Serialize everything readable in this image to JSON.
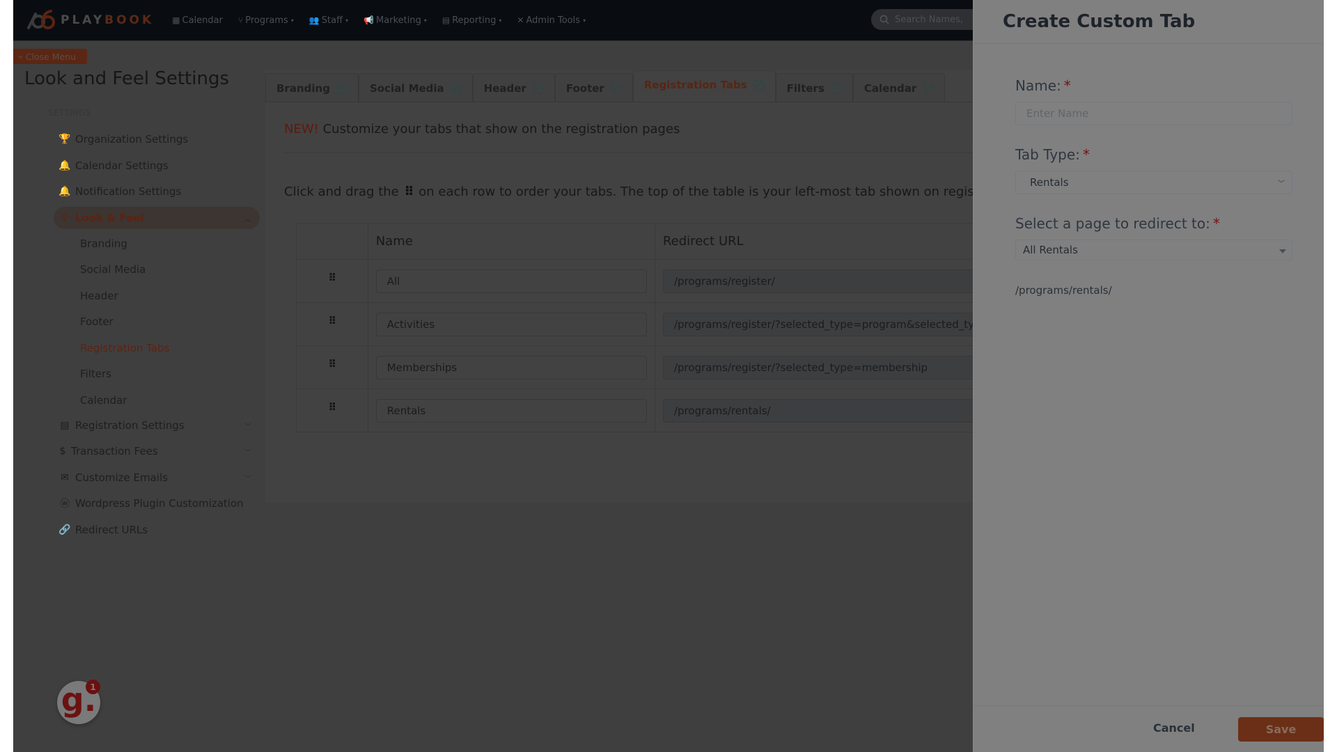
{
  "topnav": {
    "logo": {
      "part1": "PLAY",
      "part2": "BOOK"
    },
    "items": [
      {
        "label": "Calendar",
        "icon": "calendar-icon",
        "has_caret": false
      },
      {
        "label": "Programs",
        "icon": "branch-icon",
        "has_caret": true
      },
      {
        "label": "Staff",
        "icon": "users-icon",
        "has_caret": true
      },
      {
        "label": "Marketing",
        "icon": "megaphone-icon",
        "has_caret": true
      },
      {
        "label": "Reporting",
        "icon": "file-icon",
        "has_caret": true
      },
      {
        "label": "Admin Tools",
        "icon": "tools-icon",
        "has_caret": true
      }
    ],
    "search_placeholder": "Search Names,"
  },
  "close_menu_label": "Close Menu",
  "page_title": "Look and Feel Settings",
  "sidebar": {
    "header": "SETTINGS",
    "items": [
      {
        "label": "Organization Settings",
        "icon": "trophy-icon"
      },
      {
        "label": "Calendar Settings",
        "icon": "bell-icon"
      },
      {
        "label": "Notification Settings",
        "icon": "bell-icon"
      },
      {
        "label": "Look & Feel",
        "icon": "balloon-icon",
        "active": true,
        "expanded": true
      },
      {
        "label": "Registration Settings",
        "icon": "form-icon",
        "collapsible": true
      },
      {
        "label": "Transaction Fees",
        "icon": "dollar-icon",
        "collapsible": true
      },
      {
        "label": "Customize Emails",
        "icon": "envelope-icon",
        "collapsible": true
      },
      {
        "label": "Wordpress Plugin Customization",
        "icon": "wordpress-icon"
      },
      {
        "label": "Redirect URLs",
        "icon": "link-icon"
      }
    ],
    "look_feel_subitems": [
      {
        "label": "Branding"
      },
      {
        "label": "Social Media"
      },
      {
        "label": "Header"
      },
      {
        "label": "Footer"
      },
      {
        "label": "Registration Tabs",
        "current": true
      },
      {
        "label": "Filters"
      },
      {
        "label": "Calendar"
      }
    ]
  },
  "tabs": [
    {
      "label": "Branding",
      "complete": true
    },
    {
      "label": "Social Media",
      "complete": true
    },
    {
      "label": "Header",
      "complete": true
    },
    {
      "label": "Footer",
      "complete": true
    },
    {
      "label": "Registration Tabs",
      "complete": true,
      "active": true
    },
    {
      "label": "Filters",
      "complete": true
    },
    {
      "label": "Calendar",
      "complete": true
    }
  ],
  "content": {
    "notice_new": "NEW!",
    "notice_text": "Customize your tabs that show on the registration pages",
    "instructions_before": "Click and drag the",
    "instructions_after": "on each row to order your tabs. The top of the table is your left-most tab shown on registration pa",
    "table": {
      "columns": [
        "",
        "Name",
        "Redirect URL"
      ],
      "rows": [
        {
          "name": "All",
          "url": "/programs/register/"
        },
        {
          "name": "Activities",
          "url": "/programs/register/?selected_type=program&selected_ty"
        },
        {
          "name": "Memberships",
          "url": "/programs/register/?selected_type=membership"
        },
        {
          "name": "Rentals",
          "url": "/programs/rentals/"
        }
      ]
    }
  },
  "widget": {
    "letter": "g.",
    "badge_count": "1"
  },
  "drawer": {
    "title": "Create Custom Tab",
    "name_label": "Name:",
    "name_placeholder": "Enter Name",
    "name_value": "",
    "tab_type_label": "Tab Type:",
    "tab_type_value": "Rentals",
    "redirect_label": "Select a page to redirect to:",
    "redirect_value": "All Rentals",
    "redirect_preview": "/programs/rentals/",
    "required_marker": "*",
    "cancel_label": "Cancel",
    "save_label": "Save"
  },
  "colors": {
    "brand": "#c4501e",
    "success_check": "#1f8a7a",
    "required": "#d42020"
  }
}
